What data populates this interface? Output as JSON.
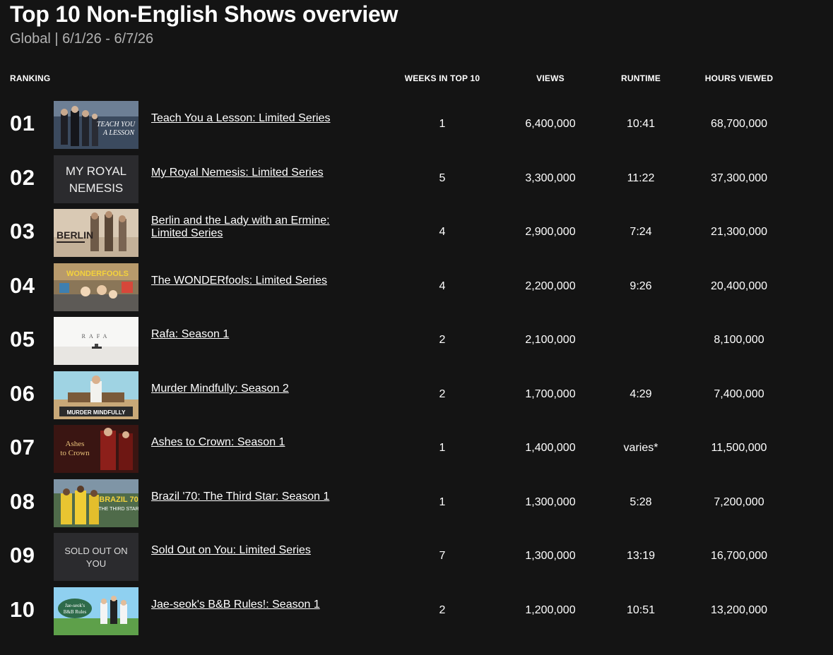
{
  "page": {
    "title": "Top 10 Non-English Shows overview",
    "subtitle": "Global | 6/1/26 - 6/7/26"
  },
  "table": {
    "headers": {
      "ranking": "RANKING",
      "weeks": "WEEKS IN TOP 10",
      "views": "VIEWS",
      "runtime": "RUNTIME",
      "hours": "HOURS VIEWED"
    },
    "rows": [
      {
        "rank": "01",
        "show": "Teach You a Lesson: Limited Series",
        "weeks": "1",
        "views": "6,400,000",
        "runtime": "10:41",
        "hours": "68,700,000",
        "thumb_text": "TEACH YOU A LESSON"
      },
      {
        "rank": "02",
        "show": "My Royal Nemesis: Limited Series",
        "weeks": "5",
        "views": "3,300,000",
        "runtime": "11:22",
        "hours": "37,300,000",
        "thumb_text": "MY ROYAL NEMESIS"
      },
      {
        "rank": "03",
        "show": "Berlin and the Lady with an Ermine: Limited Series",
        "weeks": "4",
        "views": "2,900,000",
        "runtime": "7:24",
        "hours": "21,300,000",
        "thumb_text": "BERLIN"
      },
      {
        "rank": "04",
        "show": "The WONDERfools: Limited Series",
        "weeks": "4",
        "views": "2,200,000",
        "runtime": "9:26",
        "hours": "20,400,000",
        "thumb_text": "WONDERFOOLS"
      },
      {
        "rank": "05",
        "show": "Rafa: Season 1",
        "weeks": "2",
        "views": "2,100,000",
        "runtime": "",
        "hours": "8,100,000",
        "thumb_text": "R A F A"
      },
      {
        "rank": "06",
        "show": "Murder Mindfully: Season 2",
        "weeks": "2",
        "views": "1,700,000",
        "runtime": "4:29",
        "hours": "7,400,000",
        "thumb_text": "MURDER MINDFULLY"
      },
      {
        "rank": "07",
        "show": "Ashes to Crown: Season 1",
        "weeks": "1",
        "views": "1,400,000",
        "runtime": "varies*",
        "hours": "11,500,000",
        "thumb_text": "Ashes to Crown"
      },
      {
        "rank": "08",
        "show": "Brazil '70: The Third Star: Season 1",
        "weeks": "1",
        "views": "1,300,000",
        "runtime": "5:28",
        "hours": "7,200,000",
        "thumb_text": "BRAZIL 70 THE THIRD STAR"
      },
      {
        "rank": "09",
        "show": "Sold Out on You: Limited Series",
        "weeks": "7",
        "views": "1,300,000",
        "runtime": "13:19",
        "hours": "16,700,000",
        "thumb_text": "SOLD OUT ON YOU"
      },
      {
        "rank": "10",
        "show": "Jae-seok's B&B Rules!: Season 1",
        "weeks": "2",
        "views": "1,200,000",
        "runtime": "10:51",
        "hours": "13,200,000",
        "thumb_text": "Jae-seok's B&B Rules"
      }
    ]
  }
}
